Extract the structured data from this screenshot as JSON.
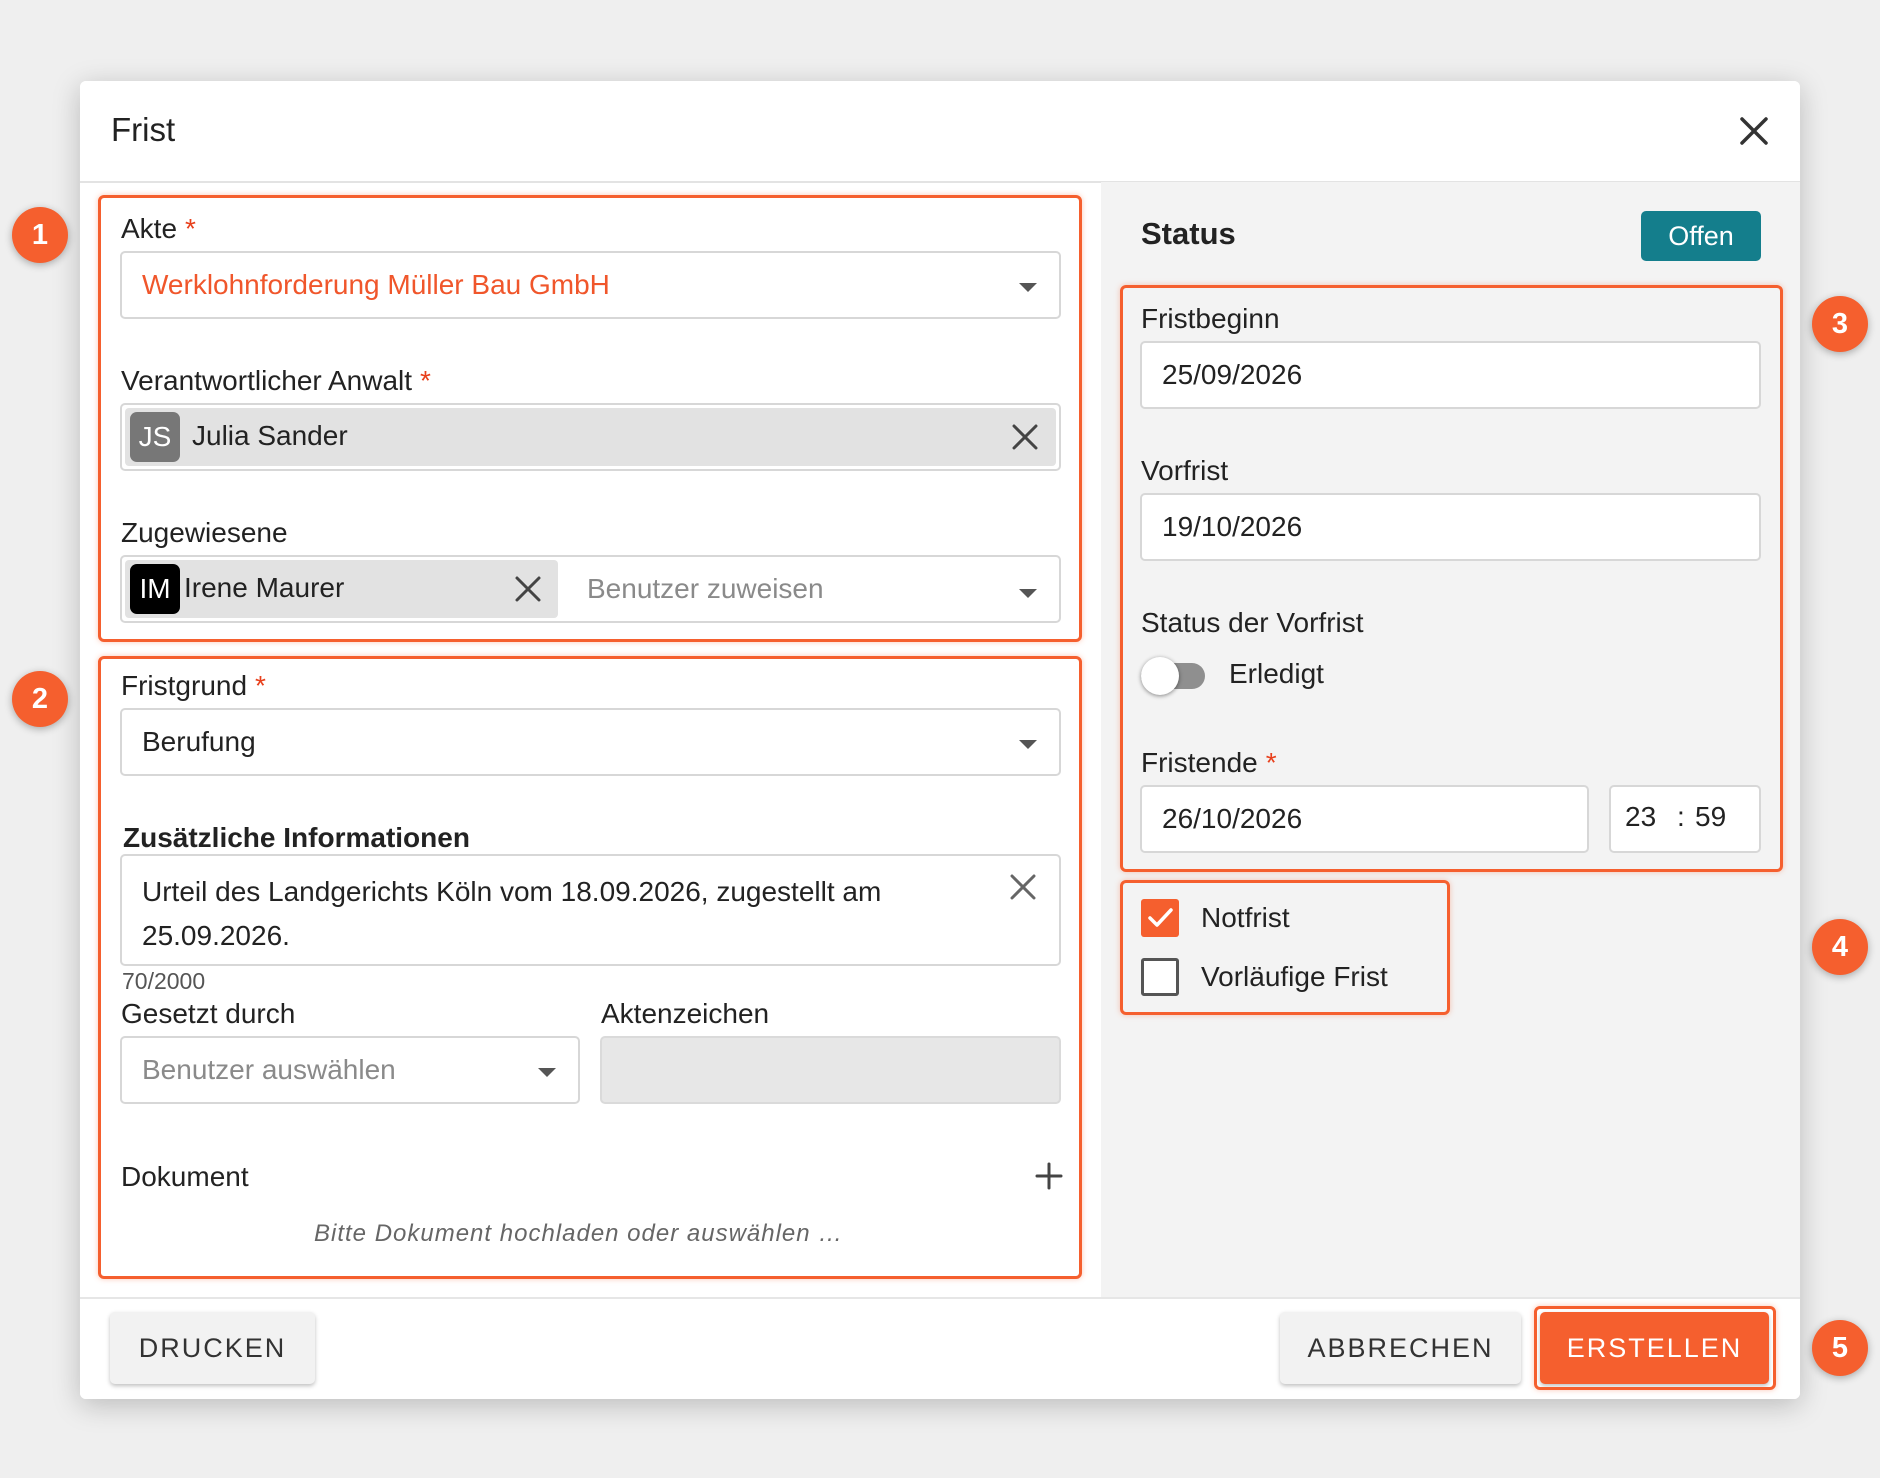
{
  "dialog": {
    "title": "Frist",
    "close_icon": "close-icon"
  },
  "akte": {
    "label": "Akte",
    "required_mark": "*",
    "value": "Werklohnforderung Müller Bau GmbH"
  },
  "anwalt": {
    "label": "Verantwortlicher Anwalt",
    "required_mark": "*",
    "avatar_initials": "JS",
    "name": "Julia Sander"
  },
  "zugewiesene": {
    "label": "Zugewiesene",
    "avatar_initials": "IM",
    "name": "Irene Maurer",
    "placeholder": "Benutzer zuweisen"
  },
  "fristgrund": {
    "label": "Fristgrund",
    "required_mark": "*",
    "value": "Berufung"
  },
  "zusatz": {
    "label": "Zusätzliche Informationen",
    "line1": "Urteil des Landgerichts Köln vom 18.09.2026, zugestellt am",
    "line2": "25.09.2026.",
    "counter": "70/2000"
  },
  "gesetzt": {
    "label": "Gesetzt durch",
    "placeholder": "Benutzer auswählen"
  },
  "aktenzeichen": {
    "label": "Aktenzeichen",
    "value": ""
  },
  "dokument": {
    "label": "Dokument",
    "hint": "Bitte Dokument hochladen oder auswählen …"
  },
  "status": {
    "title": "Status",
    "badge": "Offen"
  },
  "fristbeginn": {
    "label": "Fristbeginn",
    "value": "25/09/2026"
  },
  "vorfrist": {
    "label": "Vorfrist",
    "value": "19/10/2026"
  },
  "vorfrist_status": {
    "label": "Status der Vorfrist",
    "toggle_label": "Erledigt",
    "checked": false
  },
  "fristende": {
    "label": "Fristende",
    "required_mark": "*",
    "value": "26/10/2026",
    "hour": "23",
    "sep": ":",
    "minute": "59"
  },
  "checkboxes": {
    "notfrist": {
      "label": "Notfrist",
      "checked": true
    },
    "vorlaeufig": {
      "label": "Vorläufige Frist",
      "checked": false
    }
  },
  "footer": {
    "print_label": "DRUCKEN",
    "cancel_label": "ABBRECHEN",
    "create_label": "ERSTELLEN"
  },
  "markers": [
    "1",
    "2",
    "3",
    "4",
    "5"
  ],
  "colors": {
    "accent": "#f55f2e",
    "badge": "#147e8c",
    "required": "#e8401c",
    "akte_text": "#f0562b"
  }
}
